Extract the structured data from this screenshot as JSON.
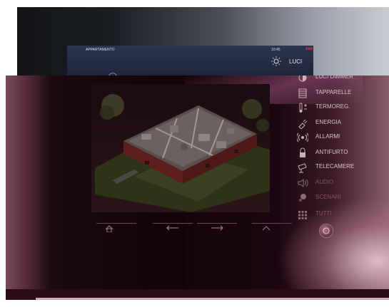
{
  "back_screen": {
    "app_title": "APPARTAMENTO",
    "time": "10:45",
    "brand": "ave",
    "menu_item": "LUCI",
    "menu_icon": "sun-icon"
  },
  "menu": {
    "items": [
      {
        "label": "LUCI DIMMER",
        "icon": "dimmer-icon",
        "dim": false
      },
      {
        "label": "TAPPARELLE",
        "icon": "shutter-icon",
        "dim": false
      },
      {
        "label": "TERMOREG.",
        "icon": "thermostat-icon",
        "dim": false
      },
      {
        "label": "ENERGIA",
        "icon": "plug-icon",
        "dim": false
      },
      {
        "label": "ALLARMI",
        "icon": "alarm-icon",
        "dim": false
      },
      {
        "label": "ANTIFURTO",
        "icon": "antitheft-icon",
        "dim": false
      },
      {
        "label": "TELECAMERE",
        "icon": "camera-icon",
        "dim": false
      },
      {
        "label": "AUDIO",
        "icon": "speaker-icon",
        "dim": true
      },
      {
        "label": "SCENARI",
        "icon": "scenario-icon",
        "dim": true
      },
      {
        "label": "TUTTI",
        "icon": "grid-icon",
        "dim": true
      }
    ]
  },
  "nav": {
    "home_icon": "home-icon",
    "back_icon": "arrow-left-icon",
    "forward_icon": "arrow-right-icon",
    "up_icon": "arrow-up-icon",
    "power_icon": "power-icon"
  },
  "colors": {
    "brand": "#ff3030",
    "menu_text": "#d8c4cc",
    "panel_bg": "#120409"
  }
}
